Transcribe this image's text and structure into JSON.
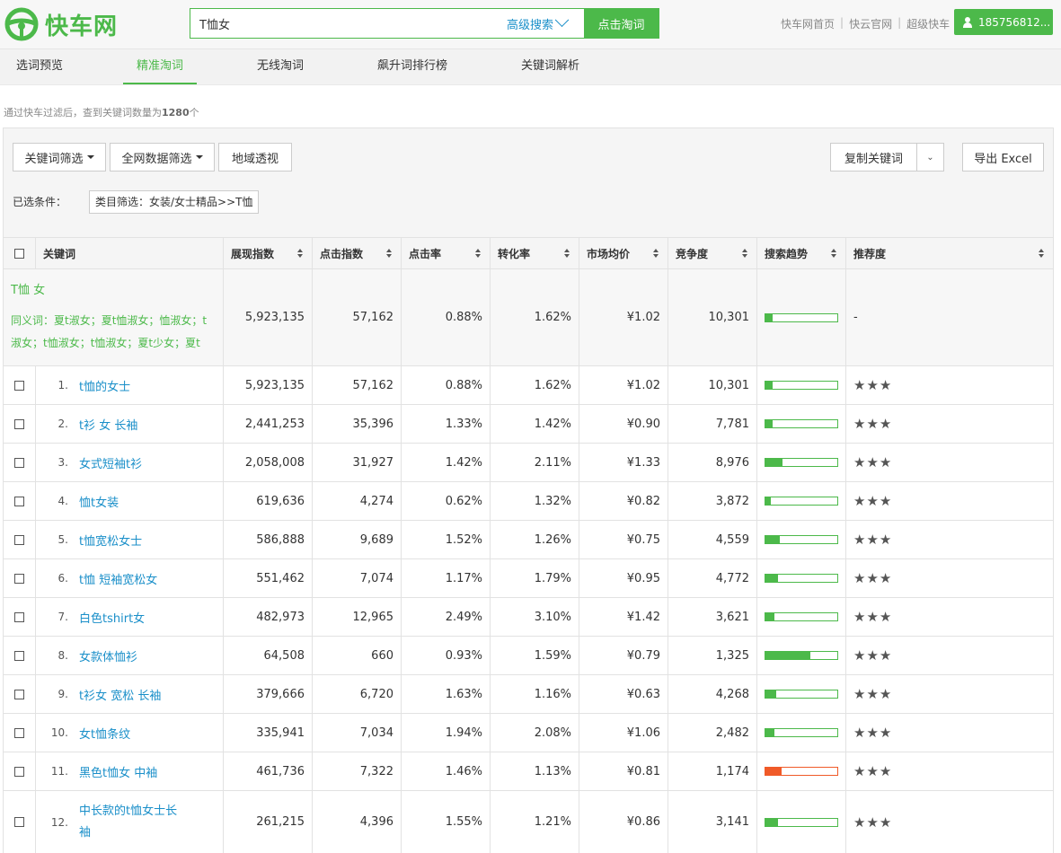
{
  "header": {
    "logo_text": "快车网",
    "search_value": "T恤女",
    "advanced_search": "高级搜索",
    "search_button": "点击淘词",
    "links": [
      "快车网首页",
      "快云官网",
      "超级快车"
    ],
    "user": "185756812..."
  },
  "nav": [
    "选词预览",
    "精准淘词",
    "无线淘词",
    "飙升词排行榜",
    "关键词解析"
  ],
  "summary": {
    "prefix": "通过快车过滤后，查到关键词数量为",
    "count": "1280",
    "suffix": "个"
  },
  "filters": {
    "keyword_filter": "关键词筛选",
    "network_filter": "全网数据筛选",
    "region": "地域透视",
    "copy": "复制关键词",
    "export": "导出 Excel",
    "selected_label": "已选条件：",
    "selected_tag": "类目筛选：女装/女士精品>>T恤"
  },
  "columns": [
    "关键词",
    "展现指数",
    "点击指数",
    "点击率",
    "转化率",
    "市场均价",
    "竞争度",
    "搜索趋势",
    "推荐度"
  ],
  "main_keyword": {
    "keyword": "T恤 女",
    "synonyms": "同义词：夏t淑女；夏t恤淑女；恤淑女；t淑女；t恤淑女；t恤淑女；夏t少女；夏t",
    "impressions": "5,923,135",
    "clicks": "57,162",
    "ctr": "0.88%",
    "cvr": "1.62%",
    "price": "¥1.02",
    "competition": "10,301",
    "trend": 0.1,
    "recommend": "-"
  },
  "rows": [
    {
      "rank": "1.",
      "keyword": "t恤的女士",
      "impressions": "5,923,135",
      "clicks": "57,162",
      "ctr": "0.88%",
      "cvr": "1.62%",
      "price": "¥1.02",
      "competition": "10,301",
      "trend": 0.1,
      "hot": false,
      "stars": "★★★"
    },
    {
      "rank": "2.",
      "keyword": "t衫 女 长袖",
      "impressions": "2,441,253",
      "clicks": "35,396",
      "ctr": "1.33%",
      "cvr": "1.42%",
      "price": "¥0.90",
      "competition": "7,781",
      "trend": 0.1,
      "hot": false,
      "stars": "★★★"
    },
    {
      "rank": "3.",
      "keyword": "女式短袖t衫",
      "impressions": "2,058,008",
      "clicks": "31,927",
      "ctr": "1.42%",
      "cvr": "2.11%",
      "price": "¥1.33",
      "competition": "8,976",
      "trend": 0.24,
      "hot": false,
      "stars": "★★★"
    },
    {
      "rank": "4.",
      "keyword": "恤t女装",
      "impressions": "619,636",
      "clicks": "4,274",
      "ctr": "0.62%",
      "cvr": "1.32%",
      "price": "¥0.82",
      "competition": "3,872",
      "trend": 0.07,
      "hot": false,
      "stars": "★★★"
    },
    {
      "rank": "5.",
      "keyword": "t恤宽松女士",
      "impressions": "586,888",
      "clicks": "9,689",
      "ctr": "1.52%",
      "cvr": "1.26%",
      "price": "¥0.75",
      "competition": "4,559",
      "trend": 0.2,
      "hot": false,
      "stars": "★★★"
    },
    {
      "rank": "6.",
      "keyword": "t恤 短袖宽松女",
      "impressions": "551,462",
      "clicks": "7,074",
      "ctr": "1.17%",
      "cvr": "1.79%",
      "price": "¥0.95",
      "competition": "4,772",
      "trend": 0.18,
      "hot": false,
      "stars": "★★★"
    },
    {
      "rank": "7.",
      "keyword": "白色tshirt女",
      "impressions": "482,973",
      "clicks": "12,965",
      "ctr": "2.49%",
      "cvr": "3.10%",
      "price": "¥1.42",
      "competition": "3,621",
      "trend": 0.13,
      "hot": false,
      "stars": "★★★"
    },
    {
      "rank": "8.",
      "keyword": "女款体恤衫",
      "impressions": "64,508",
      "clicks": "660",
      "ctr": "0.93%",
      "cvr": "1.59%",
      "price": "¥0.79",
      "competition": "1,325",
      "trend": 0.62,
      "hot": false,
      "stars": "★★★"
    },
    {
      "rank": "9.",
      "keyword": "t衫女 宽松 长袖",
      "impressions": "379,666",
      "clicks": "6,720",
      "ctr": "1.63%",
      "cvr": "1.16%",
      "price": "¥0.63",
      "competition": "4,268",
      "trend": 0.15,
      "hot": false,
      "stars": "★★★"
    },
    {
      "rank": "10.",
      "keyword": "女t恤条纹",
      "impressions": "335,941",
      "clicks": "7,034",
      "ctr": "1.94%",
      "cvr": "2.08%",
      "price": "¥1.06",
      "competition": "2,482",
      "trend": 0.13,
      "hot": false,
      "stars": "★★★"
    },
    {
      "rank": "11.",
      "keyword": "黑色t恤女 中袖",
      "impressions": "461,736",
      "clicks": "7,322",
      "ctr": "1.46%",
      "cvr": "1.13%",
      "price": "¥0.81",
      "competition": "1,174",
      "trend": 0.22,
      "hot": true,
      "stars": "★★★"
    },
    {
      "rank": "12.",
      "keyword": "中长款的t恤女士长袖",
      "impressions": "261,215",
      "clicks": "4,396",
      "ctr": "1.55%",
      "cvr": "1.21%",
      "price": "¥0.86",
      "competition": "3,141",
      "trend": 0.17,
      "hot": false,
      "stars": "★★★"
    }
  ],
  "colors": {
    "accent": "#4cb94a",
    "link": "#1a8fc9",
    "hot": "#f05a28"
  }
}
